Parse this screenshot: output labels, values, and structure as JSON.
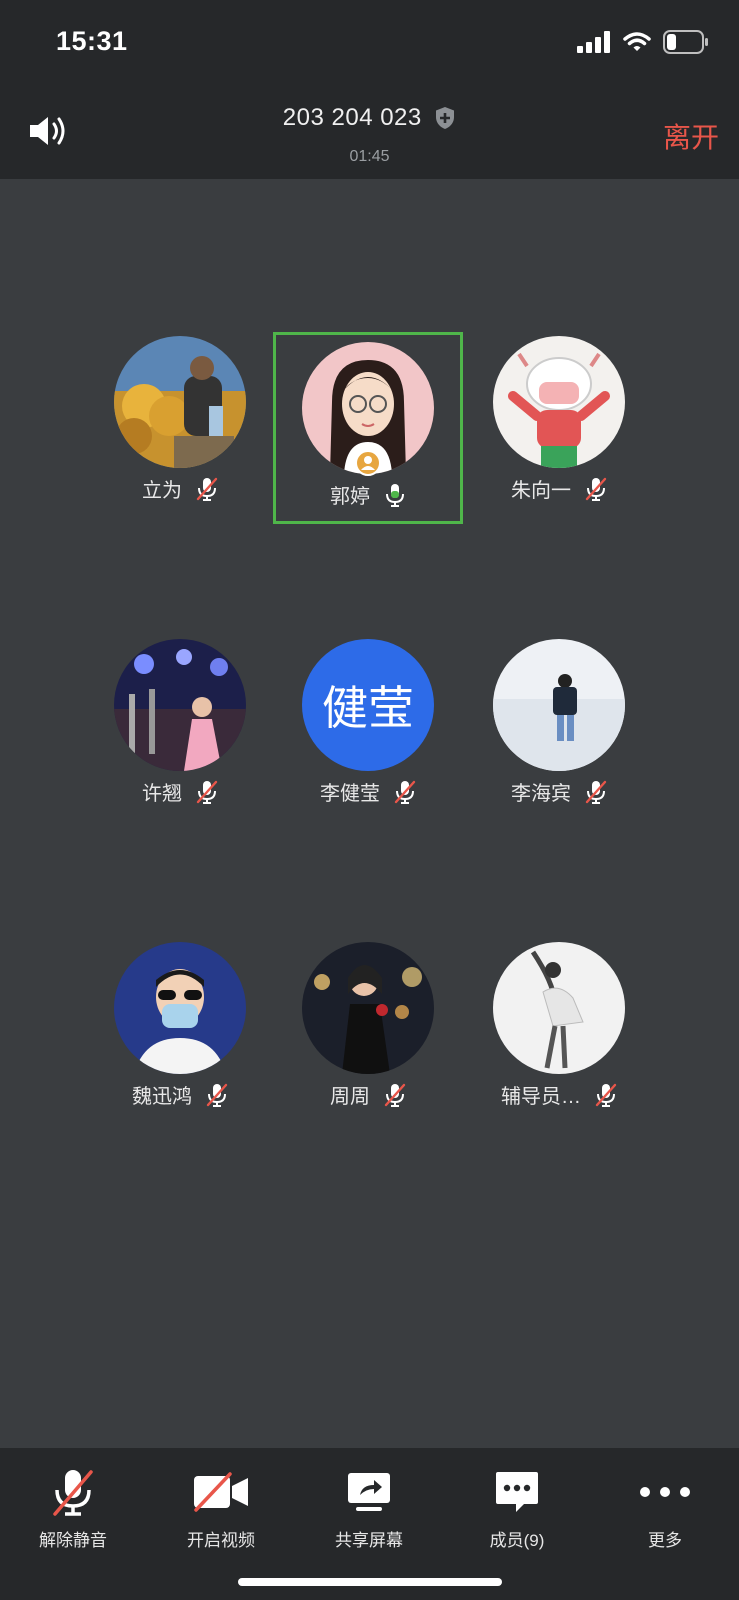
{
  "status_bar": {
    "time": "15:31"
  },
  "header": {
    "meeting_id": "203 204 023",
    "timer": "01:45",
    "leave_label": "离开"
  },
  "participants": [
    {
      "name": "立为",
      "mic": "muted",
      "avatar": "photo-outdoor"
    },
    {
      "name": "郭婷",
      "mic": "speaking",
      "avatar": "cartoon-girl",
      "host": true,
      "active": true
    },
    {
      "name": "朱向一",
      "mic": "muted",
      "avatar": "cartoon-mask"
    },
    {
      "name": "许翘",
      "mic": "muted",
      "avatar": "photo-stage"
    },
    {
      "name": "李健莹",
      "mic": "muted",
      "avatar": "text",
      "avatar_text": "健莹"
    },
    {
      "name": "李海宾",
      "mic": "muted",
      "avatar": "photo-beach"
    },
    {
      "name": "魏迅鸿",
      "mic": "muted",
      "avatar": "cartoon-mask-man"
    },
    {
      "name": "周周",
      "mic": "muted",
      "avatar": "photo-night"
    },
    {
      "name": "辅导员…",
      "mic": "muted",
      "avatar": "photo-dancer"
    }
  ],
  "toolbar": {
    "unmute": "解除静音",
    "start_video": "开启视频",
    "share_screen": "共享屏幕",
    "members": "成员(9)",
    "more": "更多"
  },
  "colors": {
    "background": "#3a3d40",
    "bar": "#26282a",
    "leave": "#e8564a",
    "active_border": "#4fb64a",
    "mute_slash": "#e8564a"
  }
}
